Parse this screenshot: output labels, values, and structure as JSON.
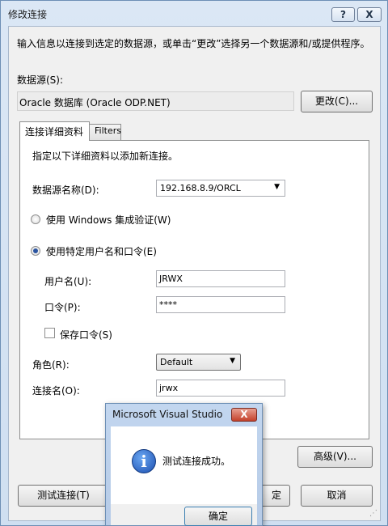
{
  "window": {
    "title": "修改连接",
    "help_label": "?",
    "close_label": "X"
  },
  "description": "输入信息以连接到选定的数据源，或单击“更改”选择另一个数据源和/或提供程序。",
  "data_source": {
    "label": "数据源(S):",
    "value": "Oracle 数据库 (Oracle ODP.NET)",
    "change_label": "更改(C)..."
  },
  "tabs": [
    {
      "label": "连接详细资料"
    },
    {
      "label": "Filters"
    }
  ],
  "details": {
    "hint": "指定以下详细资料以添加新连接。",
    "ds_name_label": "数据源名称(D):",
    "ds_name_value": "192.168.8.9/ORCL",
    "windows_auth_label": "使用 Windows 集成验证(W)",
    "specific_user_label": "使用特定用户名和口令(E)",
    "username_label": "用户名(U):",
    "username_value": "JRWX",
    "password_label": "口令(P):",
    "password_value": "****",
    "save_password_label": "保存口令(S)",
    "role_label": "角色(R):",
    "role_value": "Default",
    "conn_name_label": "连接名(O):",
    "conn_name_value": "jrwx"
  },
  "buttons": {
    "advanced": "高级(V)...",
    "test": "测试连接(T)",
    "ok_partial": "定",
    "cancel": "取消"
  },
  "msgbox": {
    "title": "Microsoft Visual Studio",
    "close_label": "X",
    "message": "测试连接成功。",
    "ok_label": "确定"
  }
}
